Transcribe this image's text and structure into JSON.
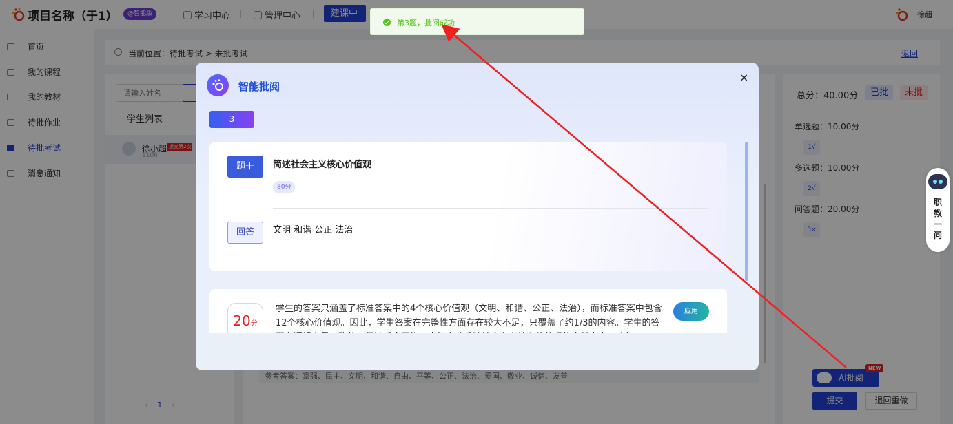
{
  "header": {
    "project_title": "项目名称（于1）",
    "badge": "@智能版",
    "nav": [
      {
        "label": "学习中心"
      },
      {
        "label": "管理中心"
      },
      {
        "label": "建课中"
      }
    ],
    "user_name": "徐超"
  },
  "sidebar": {
    "items": [
      {
        "label": "首页"
      },
      {
        "label": "我的课程"
      },
      {
        "label": "我的教材"
      },
      {
        "label": "待批作业"
      },
      {
        "label": "待批考试",
        "active": true
      },
      {
        "label": "消息通知"
      }
    ]
  },
  "breadcrumb": {
    "text": "当前位置：待批考试 > 未批考试",
    "back": "返回"
  },
  "student_panel": {
    "search_placeholder": "请输入姓名",
    "title": "学生列表",
    "students": [
      {
        "name": "徐小超",
        "tag": "提交第2次",
        "id": "1106"
      }
    ],
    "pager": {
      "prev": "‹",
      "current": "1",
      "next": "›"
    }
  },
  "main_panel": {
    "reference_answer": "参考答案：富强、民主、文明、和谐、自由、平等、公正、法治、爱国、敬业、诚信、友善"
  },
  "score_panel": {
    "total": "总分：40.00分",
    "done_label": "已批",
    "undone_label": "未批",
    "sections": [
      {
        "title": "单选题：10.00分",
        "items": [
          {
            "num": "1",
            "mark": "√"
          }
        ]
      },
      {
        "title": "多选题：10.00分",
        "items": [
          {
            "num": "2",
            "mark": "√"
          }
        ]
      },
      {
        "title": "问答题：20.00分",
        "items": [
          {
            "num": "3",
            "mark": "×"
          }
        ]
      }
    ],
    "ai_button": "AI批阅",
    "new_badge": "NEW",
    "submit": "提交",
    "reset": "退回重做"
  },
  "assistant": {
    "label_chars": [
      "职",
      "教",
      "一",
      "问"
    ]
  },
  "modal": {
    "title": "智能批阅",
    "close": "×",
    "question_tab": "3",
    "stem_label": "题干",
    "stem_text": "简述社会主义核心价值观",
    "score_pill": "80分",
    "answer_label": "回答",
    "answer_text": "文明 和谐 公正 法治",
    "review": {
      "score": "20",
      "unit": "分",
      "text": "学生的答案只涵盖了标准答案中的4个核心价值观（文明、和谐、公正、法治），而标准答案中包含12个核心价值观。因此，学生答案在完整性方面存在较大不足，只覆盖了约1/3的内容。学生的答案在逻辑上是正确的，但缺乏全面性，未能充分反映社会主义核心价值观的全部内容。此外，",
      "apply": "应用"
    }
  },
  "toast": {
    "text": "第3题，批阅成功"
  },
  "colors": {
    "accent": "#2340d6",
    "success": "#52c41a",
    "danger": "#e02020",
    "annotation_arrow": "#f02020"
  }
}
